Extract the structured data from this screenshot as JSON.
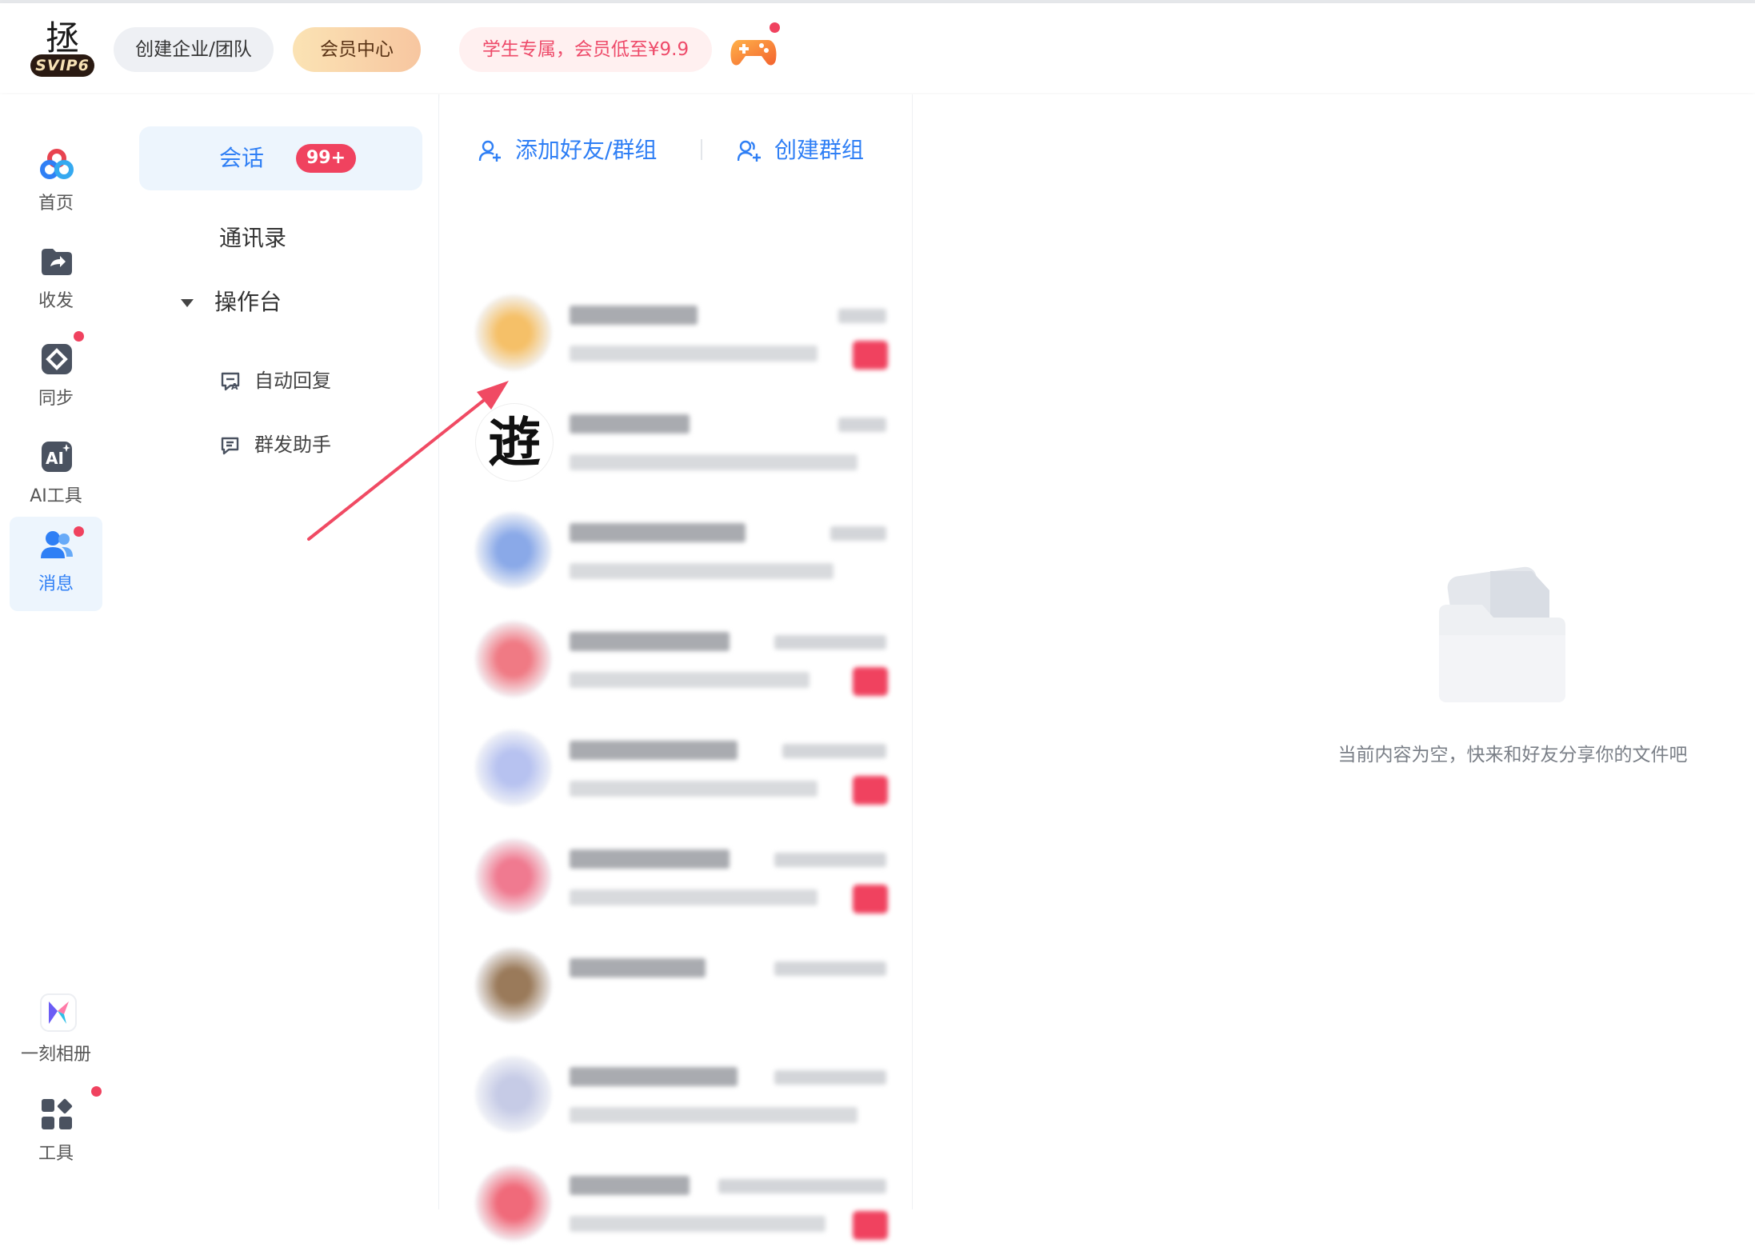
{
  "header": {
    "logo_badge_text": "SVIP6",
    "logo_glyph": "拯",
    "team_button": "创建企业/团队",
    "vip_button": "会员中心",
    "promo_button": "学生专属，会员低至¥9.9",
    "game_icon": "game-controller-icon"
  },
  "sidebar": {
    "items": [
      {
        "label": "首页",
        "icon": "cloud-logo-icon",
        "active": false
      },
      {
        "label": "收发",
        "icon": "share-folder-icon",
        "active": false
      },
      {
        "label": "同步",
        "icon": "sync-icon",
        "active": false,
        "dot": true
      },
      {
        "label": "AI工具",
        "icon": "ai-icon",
        "active": false
      },
      {
        "label": "消息",
        "icon": "users-icon",
        "active": true,
        "dot": true
      },
      {
        "label": "一刻相册",
        "icon": "album-icon",
        "active": false
      },
      {
        "label": "工具",
        "icon": "apps-grid-icon",
        "active": false,
        "dot": true
      }
    ]
  },
  "menu": {
    "session": "会话",
    "session_count": "99+",
    "contacts": "通讯录",
    "console": "操作台",
    "auto_reply": "自动回复",
    "broadcast": "群发助手"
  },
  "chat_toolbar": {
    "add_friend": "添加好友/群组",
    "create_group": "创建群组"
  },
  "chats": [
    {
      "avatar_color": "#f5c068",
      "clear": false,
      "unread": true
    },
    {
      "avatar_color": "#ffffff",
      "clear": true,
      "glyph": "逰",
      "unread": false
    },
    {
      "avatar_color": "#8aa9e8",
      "clear": false,
      "unread": false
    },
    {
      "avatar_color": "#f07a84",
      "clear": false,
      "unread": true
    },
    {
      "avatar_color": "#b7c2f0",
      "clear": false,
      "unread": true
    },
    {
      "avatar_color": "#f07a90",
      "clear": false,
      "unread": true
    },
    {
      "avatar_color": "#9a7a5a",
      "clear": false,
      "unread": false
    },
    {
      "avatar_color": "#c6cbe6",
      "clear": false,
      "unread": false
    },
    {
      "avatar_color": "#f06a7a",
      "clear": false,
      "unread": true
    }
  ],
  "empty_state": {
    "text": "当前内容为空，快来和好友分享你的文件吧"
  },
  "colors": {
    "accent": "#2f7ff5",
    "badge_red": "#f0425f"
  }
}
